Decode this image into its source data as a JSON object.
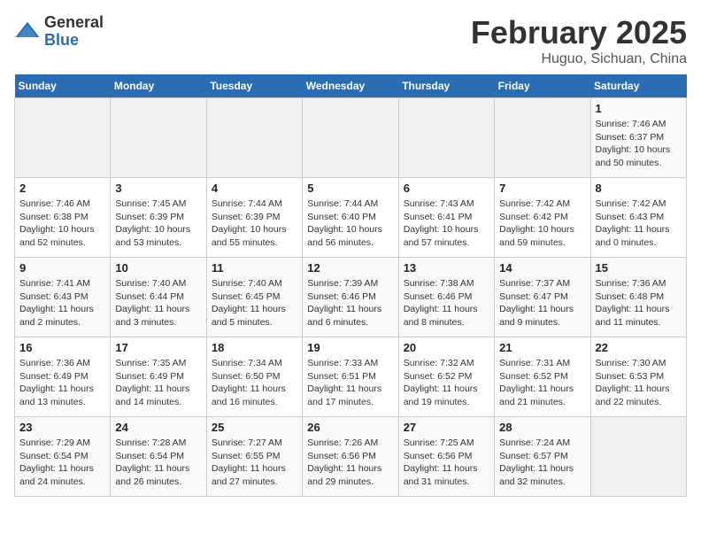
{
  "header": {
    "logo_general": "General",
    "logo_blue": "Blue",
    "title": "February 2025",
    "subtitle": "Huguo, Sichuan, China"
  },
  "weekdays": [
    "Sunday",
    "Monday",
    "Tuesday",
    "Wednesday",
    "Thursday",
    "Friday",
    "Saturday"
  ],
  "weeks": [
    [
      {
        "day": "",
        "info": ""
      },
      {
        "day": "",
        "info": ""
      },
      {
        "day": "",
        "info": ""
      },
      {
        "day": "",
        "info": ""
      },
      {
        "day": "",
        "info": ""
      },
      {
        "day": "",
        "info": ""
      },
      {
        "day": "1",
        "info": "Sunrise: 7:46 AM\nSunset: 6:37 PM\nDaylight: 10 hours and 50 minutes."
      }
    ],
    [
      {
        "day": "2",
        "info": "Sunrise: 7:46 AM\nSunset: 6:38 PM\nDaylight: 10 hours and 52 minutes."
      },
      {
        "day": "3",
        "info": "Sunrise: 7:45 AM\nSunset: 6:39 PM\nDaylight: 10 hours and 53 minutes."
      },
      {
        "day": "4",
        "info": "Sunrise: 7:44 AM\nSunset: 6:39 PM\nDaylight: 10 hours and 55 minutes."
      },
      {
        "day": "5",
        "info": "Sunrise: 7:44 AM\nSunset: 6:40 PM\nDaylight: 10 hours and 56 minutes."
      },
      {
        "day": "6",
        "info": "Sunrise: 7:43 AM\nSunset: 6:41 PM\nDaylight: 10 hours and 57 minutes."
      },
      {
        "day": "7",
        "info": "Sunrise: 7:42 AM\nSunset: 6:42 PM\nDaylight: 10 hours and 59 minutes."
      },
      {
        "day": "8",
        "info": "Sunrise: 7:42 AM\nSunset: 6:43 PM\nDaylight: 11 hours and 0 minutes."
      }
    ],
    [
      {
        "day": "9",
        "info": "Sunrise: 7:41 AM\nSunset: 6:43 PM\nDaylight: 11 hours and 2 minutes."
      },
      {
        "day": "10",
        "info": "Sunrise: 7:40 AM\nSunset: 6:44 PM\nDaylight: 11 hours and 3 minutes."
      },
      {
        "day": "11",
        "info": "Sunrise: 7:40 AM\nSunset: 6:45 PM\nDaylight: 11 hours and 5 minutes."
      },
      {
        "day": "12",
        "info": "Sunrise: 7:39 AM\nSunset: 6:46 PM\nDaylight: 11 hours and 6 minutes."
      },
      {
        "day": "13",
        "info": "Sunrise: 7:38 AM\nSunset: 6:46 PM\nDaylight: 11 hours and 8 minutes."
      },
      {
        "day": "14",
        "info": "Sunrise: 7:37 AM\nSunset: 6:47 PM\nDaylight: 11 hours and 9 minutes."
      },
      {
        "day": "15",
        "info": "Sunrise: 7:36 AM\nSunset: 6:48 PM\nDaylight: 11 hours and 11 minutes."
      }
    ],
    [
      {
        "day": "16",
        "info": "Sunrise: 7:36 AM\nSunset: 6:49 PM\nDaylight: 11 hours and 13 minutes."
      },
      {
        "day": "17",
        "info": "Sunrise: 7:35 AM\nSunset: 6:49 PM\nDaylight: 11 hours and 14 minutes."
      },
      {
        "day": "18",
        "info": "Sunrise: 7:34 AM\nSunset: 6:50 PM\nDaylight: 11 hours and 16 minutes."
      },
      {
        "day": "19",
        "info": "Sunrise: 7:33 AM\nSunset: 6:51 PM\nDaylight: 11 hours and 17 minutes."
      },
      {
        "day": "20",
        "info": "Sunrise: 7:32 AM\nSunset: 6:52 PM\nDaylight: 11 hours and 19 minutes."
      },
      {
        "day": "21",
        "info": "Sunrise: 7:31 AM\nSunset: 6:52 PM\nDaylight: 11 hours and 21 minutes."
      },
      {
        "day": "22",
        "info": "Sunrise: 7:30 AM\nSunset: 6:53 PM\nDaylight: 11 hours and 22 minutes."
      }
    ],
    [
      {
        "day": "23",
        "info": "Sunrise: 7:29 AM\nSunset: 6:54 PM\nDaylight: 11 hours and 24 minutes."
      },
      {
        "day": "24",
        "info": "Sunrise: 7:28 AM\nSunset: 6:54 PM\nDaylight: 11 hours and 26 minutes."
      },
      {
        "day": "25",
        "info": "Sunrise: 7:27 AM\nSunset: 6:55 PM\nDaylight: 11 hours and 27 minutes."
      },
      {
        "day": "26",
        "info": "Sunrise: 7:26 AM\nSunset: 6:56 PM\nDaylight: 11 hours and 29 minutes."
      },
      {
        "day": "27",
        "info": "Sunrise: 7:25 AM\nSunset: 6:56 PM\nDaylight: 11 hours and 31 minutes."
      },
      {
        "day": "28",
        "info": "Sunrise: 7:24 AM\nSunset: 6:57 PM\nDaylight: 11 hours and 32 minutes."
      },
      {
        "day": "",
        "info": ""
      }
    ]
  ]
}
